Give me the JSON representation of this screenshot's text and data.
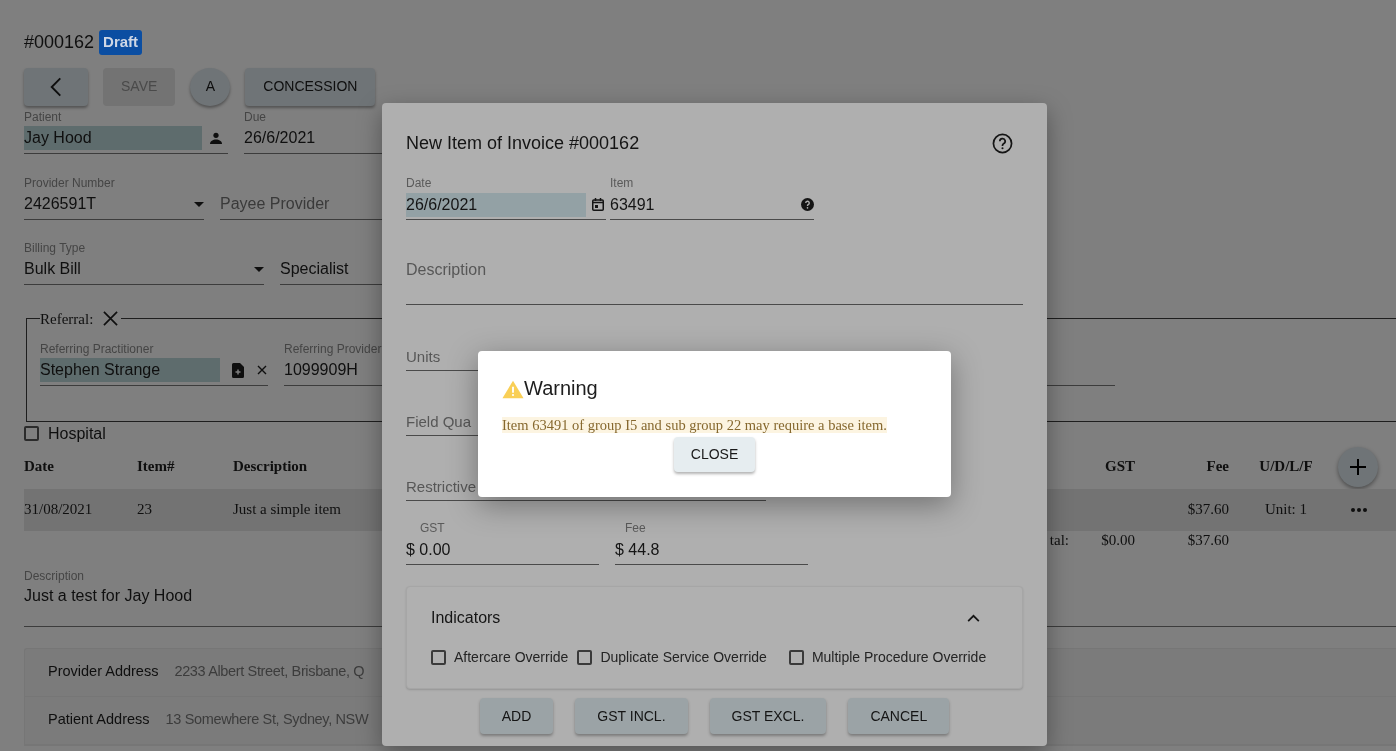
{
  "invoice": {
    "number": "#000162",
    "status": "Draft"
  },
  "toolbar": [
    {
      "kind": "back",
      "disabled": false
    },
    {
      "kind": "text",
      "label": "SAVE",
      "disabled": true
    },
    {
      "kind": "round",
      "label": "A",
      "disabled": false
    },
    {
      "kind": "text",
      "label": "CONCESSION",
      "disabled": false
    }
  ],
  "patient": {
    "label": "Patient",
    "value": "Jay Hood"
  },
  "due": {
    "label": "Due",
    "value": "26/6/2021"
  },
  "provider_number": {
    "label": "Provider Number",
    "value": "2426591T"
  },
  "payee_provider": {
    "placeholder": "Payee Provider"
  },
  "billing_type": {
    "label": "Billing Type",
    "value": "Bulk Bill"
  },
  "billing_field_2": {
    "value": "Specialist"
  },
  "referral": {
    "legend": "Referral:",
    "practitioner": {
      "label": "Referring Practitioner",
      "value": "Stephen Strange"
    },
    "provider": {
      "label": "Referring Provider",
      "value": "1099909H"
    }
  },
  "hospital": {
    "label": "Hospital",
    "checked": false
  },
  "table": {
    "columns": [
      "Date",
      "Item#",
      "Description",
      "GST",
      "Fee",
      "U/D/L/F"
    ],
    "rows": [
      {
        "date": "31/08/2021",
        "item": "23",
        "description": "Just a simple item",
        "fee": "$37.60",
        "udlf": "Unit: 1"
      }
    ],
    "totals": {
      "label": "tal:",
      "gst": "$0.00",
      "fee": "$37.60"
    }
  },
  "description": {
    "label": "Description",
    "value": "Just a test for Jay Hood"
  },
  "addresses": [
    {
      "label": "Provider Address",
      "value": "2233 Albert Street, Brisbane, Q"
    },
    {
      "label": "Patient Address",
      "value": "13 Somewhere St, Sydney, NSW"
    }
  ],
  "item_dialog": {
    "title": "New Item of Invoice #000162",
    "date": {
      "label": "Date",
      "value": "26/6/2021"
    },
    "item": {
      "label": "Item",
      "value": "63491"
    },
    "description": {
      "placeholder": "Description"
    },
    "fields": [
      {
        "placeholder": "Units"
      },
      {
        "placeholder": "Field Qua"
      },
      {
        "placeholder": "Restrictive"
      }
    ],
    "gst": {
      "label": "GST",
      "value": "$ 0.00"
    },
    "fee": {
      "label": "Fee",
      "value": "$ 44.8"
    },
    "indicators": {
      "title": "Indicators",
      "expanded": true,
      "options": [
        {
          "label": "Aftercare Override",
          "checked": false
        },
        {
          "label": "Duplicate Service Override",
          "checked": false
        },
        {
          "label": "Multiple Procedure Override",
          "checked": false
        }
      ]
    },
    "buttons": [
      "ADD",
      "GST INCL.",
      "GST EXCL.",
      "CANCEL"
    ]
  },
  "warning": {
    "title": "Warning",
    "message": "Item 63491 of group I5 and sub group 22 may require a base item.",
    "button": "CLOSE"
  }
}
